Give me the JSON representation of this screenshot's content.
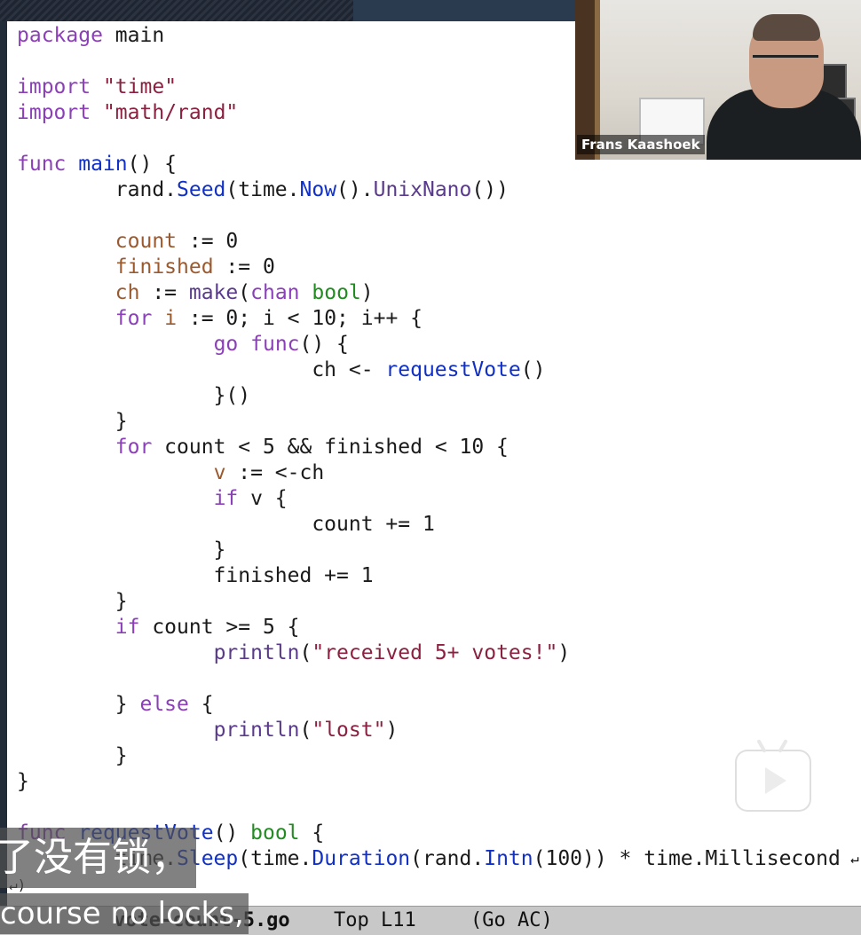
{
  "editor": {
    "lines": [
      [
        {
          "t": "package",
          "c": "kw"
        },
        {
          "t": " main"
        }
      ],
      [],
      [
        {
          "t": "import",
          "c": "kw"
        },
        {
          "t": " "
        },
        {
          "t": "\"time\"",
          "c": "str"
        }
      ],
      [
        {
          "t": "import",
          "c": "kw"
        },
        {
          "t": " "
        },
        {
          "t": "\"math/rand\"",
          "c": "str"
        }
      ],
      [],
      [
        {
          "t": "func",
          "c": "kw"
        },
        {
          "t": " "
        },
        {
          "t": "main",
          "c": "fn"
        },
        {
          "t": "() {"
        }
      ],
      [
        {
          "t": "        rand."
        },
        {
          "t": "Seed",
          "c": "fn"
        },
        {
          "t": "(time."
        },
        {
          "t": "Now",
          "c": "fn"
        },
        {
          "t": "()."
        },
        {
          "t": "UnixNano",
          "c": "bfn"
        },
        {
          "t": "())"
        }
      ],
      [],
      [
        {
          "t": "        "
        },
        {
          "t": "count",
          "c": "var"
        },
        {
          "t": " := 0"
        }
      ],
      [
        {
          "t": "        "
        },
        {
          "t": "finished",
          "c": "var"
        },
        {
          "t": " := 0"
        }
      ],
      [
        {
          "t": "        "
        },
        {
          "t": "ch",
          "c": "var"
        },
        {
          "t": " := "
        },
        {
          "t": "make",
          "c": "bfn"
        },
        {
          "t": "("
        },
        {
          "t": "chan",
          "c": "kw"
        },
        {
          "t": " "
        },
        {
          "t": "bool",
          "c": "typ"
        },
        {
          "t": ")"
        }
      ],
      [
        {
          "t": "        "
        },
        {
          "t": "for",
          "c": "kw"
        },
        {
          "t": " "
        },
        {
          "t": "i",
          "c": "var"
        },
        {
          "t": " := 0; i < 10; i++ {"
        }
      ],
      [
        {
          "t": "                "
        },
        {
          "t": "go",
          "c": "kw"
        },
        {
          "t": " "
        },
        {
          "t": "func",
          "c": "kw"
        },
        {
          "t": "() {"
        }
      ],
      [
        {
          "t": "                        ch <- "
        },
        {
          "t": "requestVote",
          "c": "fn"
        },
        {
          "t": "()"
        }
      ],
      [
        {
          "t": "                }()"
        }
      ],
      [
        {
          "t": "        }"
        }
      ],
      [
        {
          "t": "        "
        },
        {
          "t": "for",
          "c": "kw"
        },
        {
          "t": " count < 5 && finished < 10 {"
        }
      ],
      [
        {
          "t": "                "
        },
        {
          "t": "v",
          "c": "var"
        },
        {
          "t": " := <-ch"
        }
      ],
      [
        {
          "t": "                "
        },
        {
          "t": "if",
          "c": "kw"
        },
        {
          "t": " v {"
        }
      ],
      [
        {
          "t": "                        count += 1"
        }
      ],
      [
        {
          "t": "                }"
        }
      ],
      [
        {
          "t": "                finished += 1"
        }
      ],
      [
        {
          "t": "        }"
        }
      ],
      [
        {
          "t": "        "
        },
        {
          "t": "if",
          "c": "kw"
        },
        {
          "t": " count >= 5 {"
        }
      ],
      [
        {
          "t": "                "
        },
        {
          "t": "println",
          "c": "bfn"
        },
        {
          "t": "("
        },
        {
          "t": "\"received 5+ votes!\"",
          "c": "str"
        },
        {
          "t": ")"
        }
      ],
      [],
      [
        {
          "t": "        } "
        },
        {
          "t": "else",
          "c": "kw"
        },
        {
          "t": " {"
        }
      ],
      [
        {
          "t": "                "
        },
        {
          "t": "println",
          "c": "bfn"
        },
        {
          "t": "("
        },
        {
          "t": "\"lost\"",
          "c": "str"
        },
        {
          "t": ")"
        }
      ],
      [
        {
          "t": "        }"
        }
      ],
      [
        {
          "t": "}"
        }
      ],
      [],
      [
        {
          "t": "func",
          "c": "kw"
        },
        {
          "t": " "
        },
        {
          "t": "requestVote",
          "c": "fn"
        },
        {
          "t": "() "
        },
        {
          "t": "bool",
          "c": "typ"
        },
        {
          "t": " {"
        }
      ],
      [
        {
          "t": "        time."
        },
        {
          "t": "Sleep",
          "c": "fn"
        },
        {
          "t": "(time."
        },
        {
          "t": "Duration",
          "c": "fn"
        },
        {
          "t": "(rand."
        },
        {
          "t": "Intn",
          "c": "fn"
        },
        {
          "t": "(100)) * time.Millisecond"
        }
      ]
    ]
  },
  "fringe": {
    "left": "↵)",
    "right": "↵"
  },
  "modeline": {
    "buffer": "vote-count-5.go",
    "position": "Top L11",
    "mode": "(Go AC)"
  },
  "webcam": {
    "name": "Frans Kaashoek"
  },
  "subtitles": {
    "zh": "了没有锁，",
    "en": "course no locks,"
  },
  "colors": {
    "keyword": "#8b3fb8",
    "function": "#1030c8",
    "string": "#8b2040",
    "variable": "#9a5a30",
    "type": "#228b22"
  }
}
